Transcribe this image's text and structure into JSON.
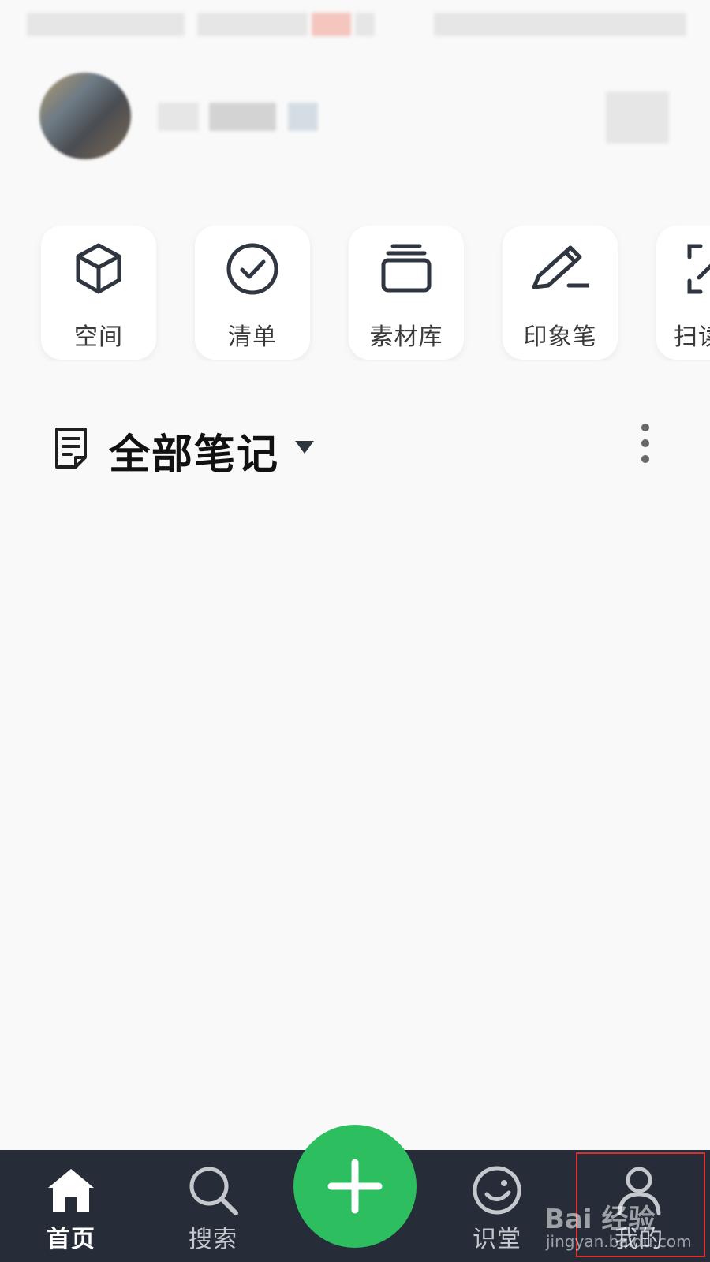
{
  "quick_actions": [
    {
      "label": "空间",
      "icon": "cube-icon"
    },
    {
      "label": "清单",
      "icon": "check-circle-icon"
    },
    {
      "label": "素材库",
      "icon": "stack-icon"
    },
    {
      "label": "印象笔",
      "icon": "pen-icon"
    },
    {
      "label": "扫读",
      "icon": "scan-icon"
    }
  ],
  "notes": {
    "title": "全部笔记",
    "title_icon": "document-icon",
    "dropdown_icon": "caret-down-icon",
    "more_icon": "more-vertical-icon"
  },
  "bottom_nav": {
    "items": [
      {
        "label": "首页",
        "icon": "home-icon",
        "active": true
      },
      {
        "label": "搜索",
        "icon": "search-icon",
        "active": false
      },
      {
        "label": "识堂",
        "icon": "smile-circle-icon",
        "active": false
      },
      {
        "label": "我的",
        "icon": "person-icon",
        "active": false
      }
    ],
    "fab_icon": "plus-icon"
  },
  "watermark": {
    "line1": "Bai 经验",
    "line2": "jingyan.baidu.com"
  },
  "colors": {
    "accent": "#2dbe60",
    "nav_bg": "#262d38",
    "highlight": "#e02c2c",
    "icon": "#2f3640"
  }
}
